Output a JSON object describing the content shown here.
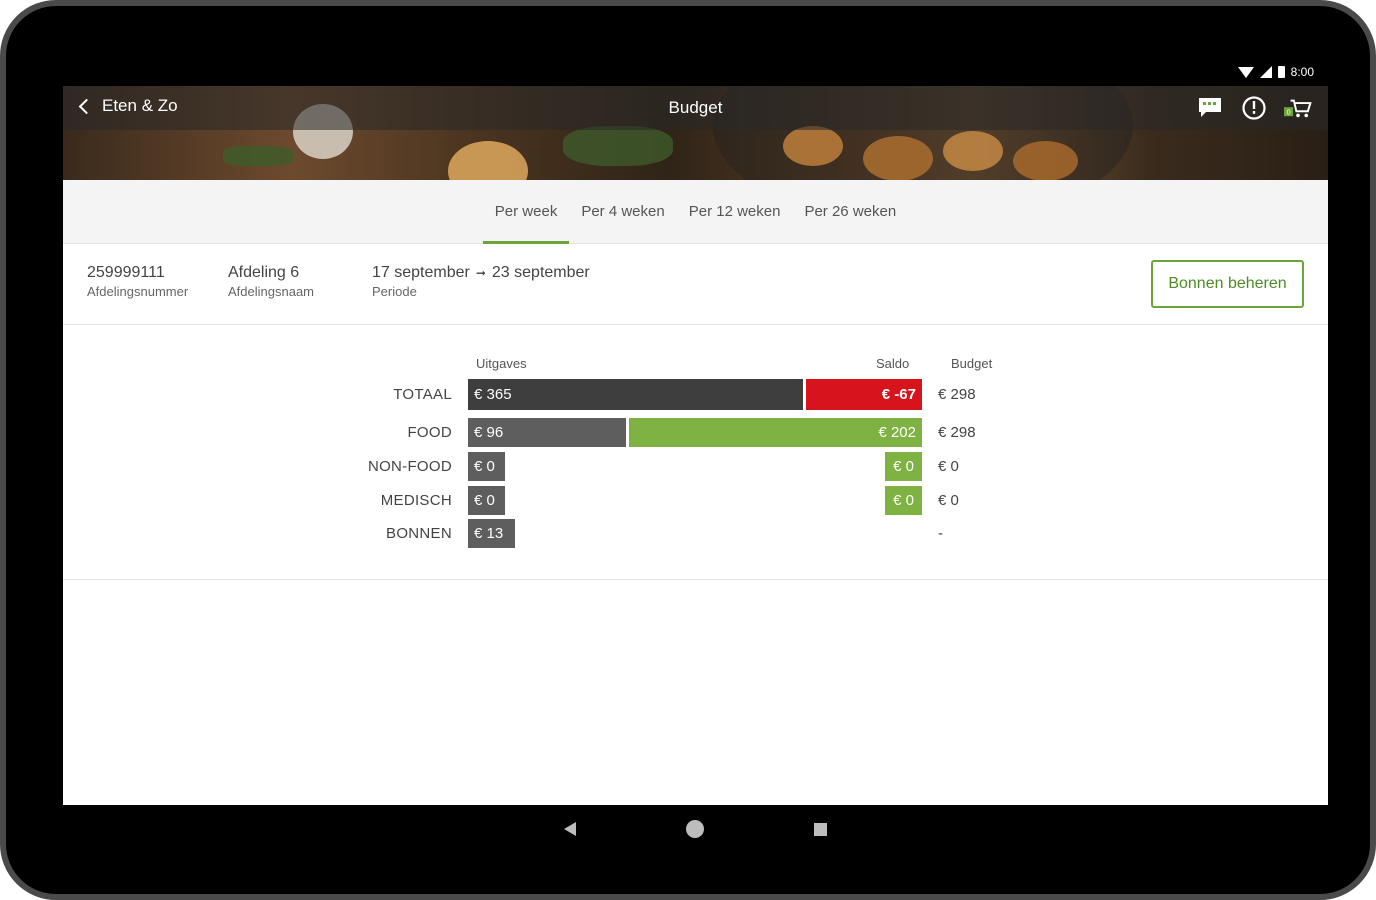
{
  "status_bar": {
    "time": "8:00"
  },
  "app_bar": {
    "back_label": "Eten & Zo",
    "title": "Budget",
    "cart_count": "0"
  },
  "tabs": [
    {
      "label": "Per week",
      "active": true
    },
    {
      "label": "Per 4 weken",
      "active": false
    },
    {
      "label": "Per 12 weken",
      "active": false
    },
    {
      "label": "Per 26 weken",
      "active": false
    }
  ],
  "info": {
    "department_number": "259999111",
    "department_number_label": "Afdelingsnummer",
    "department_name": "Afdeling 6",
    "department_name_label": "Afdelingsnaam",
    "period_start": "17 september",
    "period_end": "23 september",
    "period_label": "Periode",
    "manage_button": "Bonnen beheren"
  },
  "budget": {
    "headers": {
      "spend": "Uitgaves",
      "saldo": "Saldo",
      "budget": "Budget"
    },
    "rows": [
      {
        "label": "TOTAAL",
        "spend": "€ 365",
        "saldo": "€ -67",
        "budget": "€ 298"
      },
      {
        "label": "FOOD",
        "spend": "€ 96",
        "saldo": "€ 202",
        "budget": "€ 298"
      },
      {
        "label": "NON-FOOD",
        "spend": "€ 0",
        "saldo": "€ 0",
        "budget": "€ 0"
      },
      {
        "label": "MEDISCH",
        "spend": "€ 0",
        "saldo": "€ 0",
        "budget": "€ 0"
      },
      {
        "label": "BONNEN",
        "spend": "€ 13",
        "saldo": "",
        "budget": "-"
      }
    ]
  },
  "colors": {
    "accent": "#6aa43a",
    "negative": "#d7141e",
    "positive": "#7eb243",
    "bar_dark": "#3e3e3e"
  }
}
